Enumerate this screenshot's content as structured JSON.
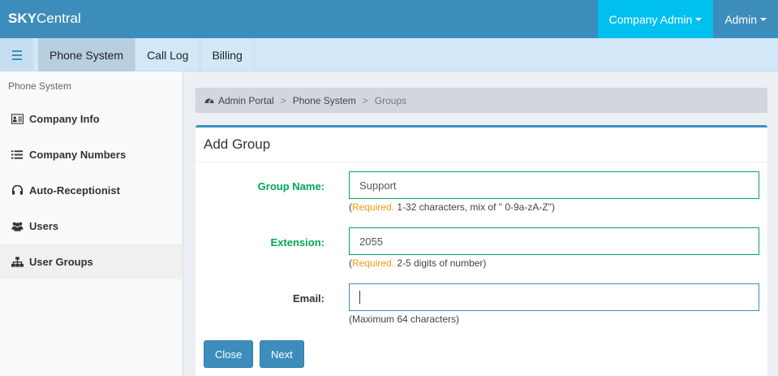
{
  "header": {
    "brand_bold": "SKY",
    "brand_rest": "Central",
    "company_admin": "Company Admin",
    "admin": "Admin",
    "accent_color": "#3c8dbc",
    "active_nav_color": "#00c0ef"
  },
  "tabs": [
    {
      "label": "Phone System",
      "active": true
    },
    {
      "label": "Call Log",
      "active": false
    },
    {
      "label": "Billing",
      "active": false
    }
  ],
  "sidebar": {
    "header": "Phone System",
    "items": [
      {
        "label": "Company Info",
        "icon": "id-card-icon"
      },
      {
        "label": "Company Numbers",
        "icon": "list-icon"
      },
      {
        "label": "Auto-Receptionist",
        "icon": "headset-icon"
      },
      {
        "label": "Users",
        "icon": "users-icon"
      },
      {
        "label": "User Groups",
        "icon": "sitemap-icon",
        "active": true
      }
    ]
  },
  "breadcrumb": {
    "items": [
      "Admin Portal",
      "Phone System",
      "Groups"
    ],
    "separator": ">"
  },
  "form": {
    "title": "Add Group",
    "group_name": {
      "label": "Group Name:",
      "value": "Support",
      "help_required": "Required.",
      "help_text": " 1-32 characters, mix of \" 0-9a-zA-Z\")"
    },
    "extension": {
      "label": "Extension:",
      "value": "2055",
      "help_required": "Required.",
      "help_text": " 2-5 digits of number)"
    },
    "email": {
      "label": "Email:",
      "value": "",
      "help_text": "(Maximum 64 characters)"
    },
    "close_label": "Close",
    "next_label": "Next"
  }
}
